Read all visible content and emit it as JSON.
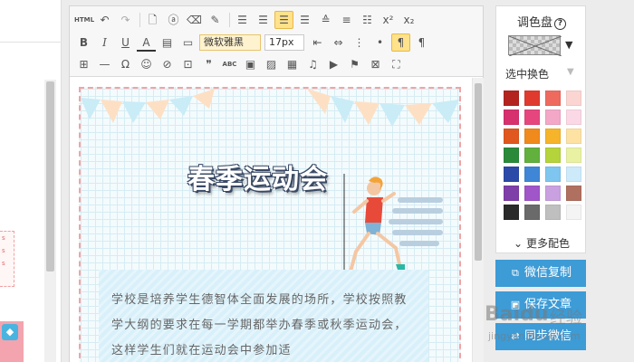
{
  "editor": {
    "font_family": "微软雅黑",
    "font_size": "17px",
    "toolbar_icons_row1": [
      "html-icon",
      "undo-icon",
      "redo-icon",
      "page-icon",
      "format-icon",
      "eraser-icon",
      "brush-icon",
      "align-left-icon",
      "align-center-icon",
      "align-justify-icon",
      "align-right-icon",
      "line-height-icon",
      "list-icon",
      "superscript-icon",
      "subscript-icon"
    ],
    "html_label": "HTML",
    "bold_label": "B",
    "italic_label": "I",
    "underline_label": "U",
    "font_color_label": "A",
    "text_label": "ABC",
    "x2_label": "x²",
    "x2b_label": "x₂"
  },
  "poster": {
    "title": "春季运动会",
    "paragraph": "学校是培养学生德智体全面发展的场所，学校按照教学大纲的要求在每一学期都举办春季或秋季运动会，这样学生们就在运动会中参加适"
  },
  "palette": {
    "title": "调色盘",
    "help": "?",
    "mode_label": "选中换色",
    "more_label": "更多配色",
    "swatches": [
      "#b3241f",
      "#e03a2f",
      "#ee6a5f",
      "#fbd5d1",
      "#d6306e",
      "#e6467e",
      "#f2a8c6",
      "#fbd8e5",
      "#e0581f",
      "#f08a1c",
      "#f6b42b",
      "#fde2a4",
      "#2a8a3a",
      "#62b13e",
      "#b5d33b",
      "#e9f2a3",
      "#2b4aa8",
      "#3f87d6",
      "#7ec6ef",
      "#cdeafa",
      "#7e3fa8",
      "#a055c8",
      "#c9a0e0",
      "#b07060",
      "#2a2a2a",
      "#6a6a6a",
      "#bfbfbf",
      "#f4f4f4"
    ]
  },
  "actions": {
    "wechat_copy": "微信复制",
    "save_article": "保存文章",
    "sync_wechat": "同步微信"
  },
  "watermark": {
    "brand": "Baidu",
    "suffix": "经验",
    "url": "jingyan.baidu.com"
  },
  "left_panel": {
    "red_text": [
      "s",
      "s",
      "s"
    ]
  }
}
